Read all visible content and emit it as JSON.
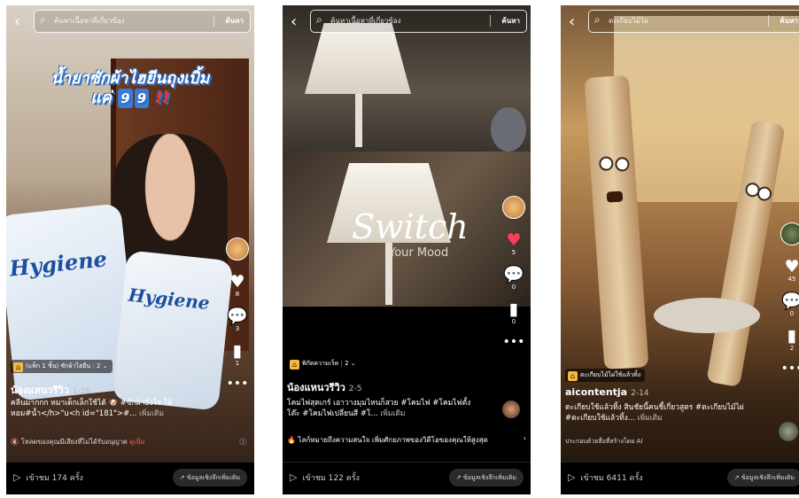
{
  "screens": [
    {
      "search_placeholder": "ค้นหาเนื้อหาที่เกี่ยวข้อง",
      "search_button": "ค้นหา",
      "headline_prefix": "น้ำยาซักผ้าไฮยีนถุงเบิ้ม",
      "headline_suffix": "แค่",
      "headline_nums": [
        "9",
        "9"
      ],
      "headline_mark": "!!",
      "brand_text": "Hygiene",
      "likes": "8",
      "comments": "3",
      "saves": "1",
      "tag_text": "(แพ็ก 1 ชิ้น) ซักผ้าไฮยีน",
      "tag_count": "2",
      "author": "น้องแหนวรีวิว",
      "date": "1-26",
      "caption": "คลีนมากกก หมาเด็กเล็กใช้ได้ 🐶 #ซักผ้าอิ่งใจ ให้หอม#น้ำ</h>\"u<h id=\"181\">#...",
      "more_label": "เพิ่มเติม",
      "notice_prefix": "โหลดของคุณมีเสียงที่ไม่ได้รับอนุญาต",
      "notice_link": "ดูเพิ่ม",
      "views": "เข้าชม 174 ครั้ง",
      "insight": "ข้อมูลเชิงลึกเพิ่มเติม"
    },
    {
      "search_placeholder": "ค้นหาเนื้อหาที่เกี่ยวข้อง",
      "search_button": "ค้นหา",
      "overlay_title": "Switch",
      "overlay_subtitle": "Your Mood",
      "likes": "5",
      "comments": "0",
      "saves": "0",
      "tag_text": "พิกัดความเร็ด",
      "tag_count": "2",
      "author": "น้องแหนวรีวิว",
      "date": "2-5",
      "caption": "โคมไฟสุดเกร์ เอาวางมุมไหนก็สวย #โคมไฟ #โคมไฟตั้งโต๊ะ #โคมไฟเปลี่ยนสี #โ...",
      "more_label": "เพิ่มเติม",
      "banner": "ไลก์หมายถึงความสนใจ เพิ่มศักยภาพของวิดีโอของคุณให้สูงสุด",
      "views": "เข้าชม 122 ครั้ง",
      "insight": "ข้อมูลเชิงลึกเพิ่มเติม"
    },
    {
      "search_placeholder": "ตะเกียบไม้ไผ่",
      "search_button": "ค้นหา",
      "likes": "45",
      "comments": "0",
      "saves": "2",
      "tag_text": "ตะเกียบไม้ไผ่ใช้แล้วทิ้ง",
      "author": "aicontentja",
      "date": "2-14",
      "caption": "ตะเกียบใช้แล้วทิ้ง สินชัยนี้คนชี้เกี่ยวสูตร #ตะเกียบไม้ไผ่ #ตะเกียบใช้แล้วทิ้ง...",
      "more_label": "เพิ่มเติม",
      "ai_label": "ประกอบด้วยสื่อที่สร้างโดย AI",
      "views": "เข้าชม 6411 ครั้ง",
      "insight": "ข้อมูลเชิงลึกเพิ่มเติม"
    }
  ],
  "icons": {
    "back": "back-arrow-icon",
    "search": "search-icon",
    "like": "heart-icon",
    "comment": "comment-icon",
    "save": "bookmark-icon",
    "more": "more-icon",
    "play": "play-icon",
    "chart": "chart-icon"
  },
  "colors": {
    "like_active": "#ff3b5c",
    "tag_icon": "#f6b83b",
    "notice_link": "#ff5a4e"
  }
}
